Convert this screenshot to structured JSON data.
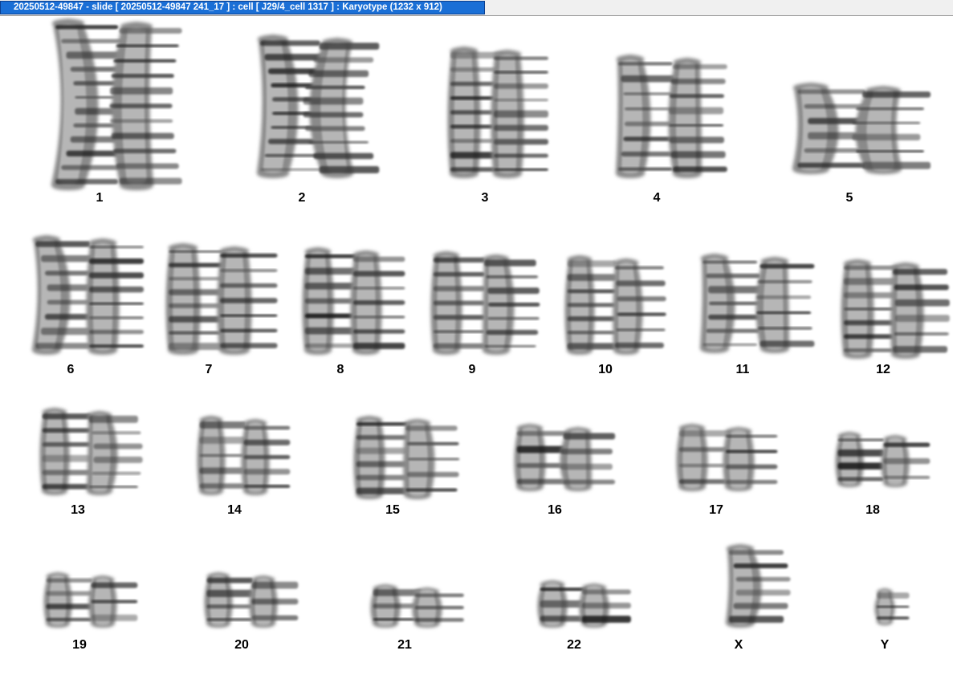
{
  "window": {
    "title": "20250512-49847 - slide [ 20250512-49847 241_17 ] : cell [ J29/4_cell 1317 ] : Karyotype  (1232 x 912)"
  },
  "karyotype": {
    "chromosomes": [
      {
        "label": "1"
      },
      {
        "label": "2"
      },
      {
        "label": "3"
      },
      {
        "label": "4"
      },
      {
        "label": "5"
      },
      {
        "label": "6"
      },
      {
        "label": "7"
      },
      {
        "label": "8"
      },
      {
        "label": "9"
      },
      {
        "label": "10"
      },
      {
        "label": "11"
      },
      {
        "label": "12"
      },
      {
        "label": "13"
      },
      {
        "label": "14"
      },
      {
        "label": "15"
      },
      {
        "label": "16"
      },
      {
        "label": "17"
      },
      {
        "label": "18"
      },
      {
        "label": "19"
      },
      {
        "label": "20"
      },
      {
        "label": "21"
      },
      {
        "label": "22"
      },
      {
        "label": "X"
      },
      {
        "label": "Y"
      }
    ]
  }
}
